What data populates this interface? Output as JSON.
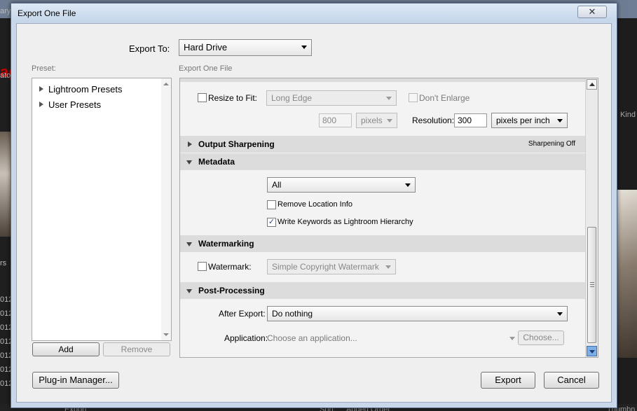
{
  "background": {
    "left_texts": [
      "ary",
      "ato",
      "rs",
      "012",
      "012",
      "012",
      "012",
      "012",
      "012",
      "012",
      "012"
    ],
    "left_red_text": "ag",
    "right_text": "Kind",
    "bottom_texts": [
      "Export",
      "Sort:",
      "Added Order",
      "Thumbn"
    ]
  },
  "dialog": {
    "title": "Export One File",
    "close_glyph": "✕",
    "export_to_label": "Export To:",
    "export_to_value": "Hard Drive",
    "preset_label": "Preset:",
    "settings_label": "Export One File",
    "presets": [
      {
        "label": "Lightroom Presets"
      },
      {
        "label": "User Presets"
      }
    ],
    "add_label": "Add",
    "remove_label": "Remove",
    "plugin_manager_label": "Plug-in Manager...",
    "export_label": "Export",
    "cancel_label": "Cancel"
  },
  "image_sizing": {
    "resize_label": "Resize to Fit:",
    "resize_checked": false,
    "resize_mode": "Long Edge",
    "dont_enlarge_label": "Don't Enlarge",
    "dont_enlarge_checked": false,
    "size_value": "800",
    "size_unit": "pixels",
    "resolution_label": "Resolution:",
    "resolution_value": "300",
    "resolution_unit": "pixels per inch"
  },
  "output_sharpening": {
    "header": "Output Sharpening",
    "status": "Sharpening Off"
  },
  "metadata": {
    "header": "Metadata",
    "value": "All",
    "remove_location_label": "Remove Location Info",
    "remove_location_checked": false,
    "write_keywords_label": "Write Keywords as Lightroom Hierarchy",
    "write_keywords_checked": true
  },
  "watermarking": {
    "header": "Watermarking",
    "watermark_label": "Watermark:",
    "watermark_checked": false,
    "watermark_value": "Simple Copyright Watermark"
  },
  "post_processing": {
    "header": "Post-Processing",
    "after_export_label": "After Export:",
    "after_export_value": "Do nothing",
    "application_label": "Application:",
    "application_placeholder": "Choose an application...",
    "choose_label": "Choose..."
  },
  "glyphs": {
    "check": "✓"
  }
}
